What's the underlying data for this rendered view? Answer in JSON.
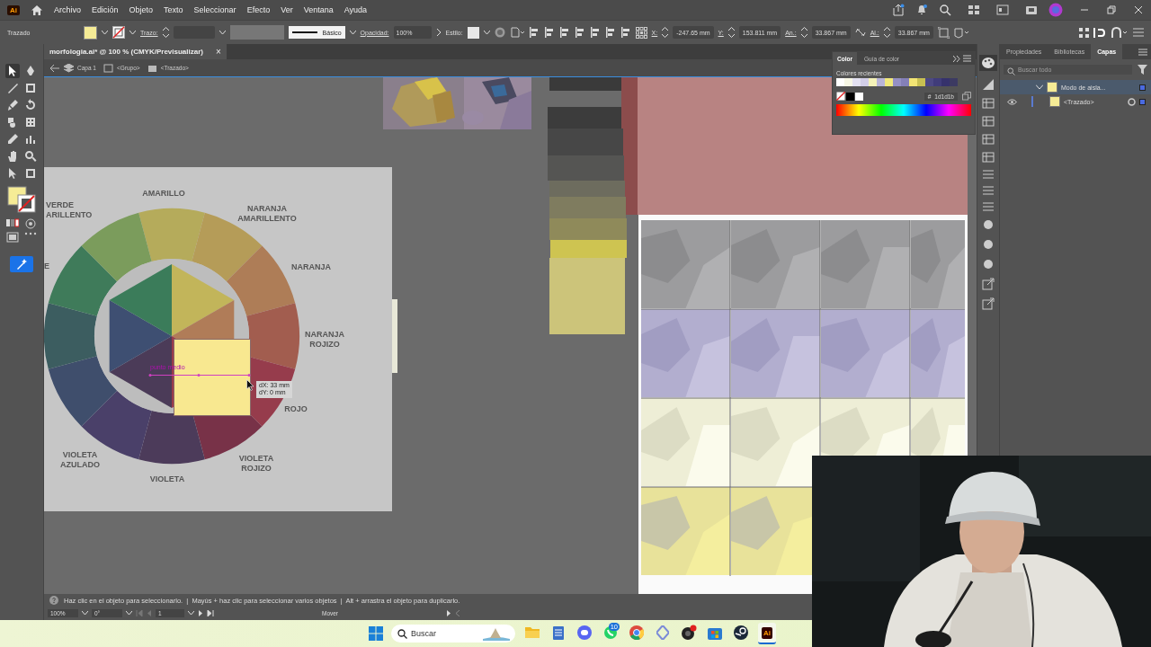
{
  "app_logo": "Ai",
  "menu": [
    "Archivo",
    "Edición",
    "Objeto",
    "Texto",
    "Seleccionar",
    "Efecto",
    "Ver",
    "Ventana",
    "Ayuda"
  ],
  "control_bar": {
    "selection": "Trazado",
    "stroke_label": "Trazo:",
    "stroke_profile": "Básico",
    "opacity_label": "Opacidad:",
    "opacity": "100%",
    "style_label": "Estilo:",
    "x_label": "X:",
    "x": "-247.65 mm",
    "y_label": "Y:",
    "y": "153.811 mm",
    "width_label": "An.:",
    "width": "33.867 mm",
    "height_label": "Al.:",
    "height": "33.867 mm"
  },
  "document_tab": {
    "title": "morfologia.ai* @ 100 % (CMYK/Previsualizar)",
    "close": "×"
  },
  "breadcrumb": [
    "Capa 1",
    "<Grupo>",
    "<Trazado>"
  ],
  "color_wheel": {
    "labels": [
      {
        "lines": [
          "VERDE",
          "ARILLENTO"
        ]
      },
      {
        "lines": [
          "AMARILLO"
        ]
      },
      {
        "lines": [
          "NARANJA",
          "AMARILLENTO"
        ]
      },
      {
        "lines": [
          "E"
        ]
      },
      {
        "lines": [
          "NARANJA"
        ]
      },
      {
        "lines": [
          "NARANJA",
          "ROJIZO"
        ]
      },
      {
        "lines": [
          "ROJO"
        ]
      },
      {
        "lines": [
          "VIOLETA",
          "AZULADO"
        ]
      },
      {
        "lines": [
          "VIOLETA"
        ]
      },
      {
        "lines": [
          "VIOLETA",
          "ROJIZO"
        ]
      }
    ],
    "guide_label": "punto medio",
    "tooltip": {
      "dx": "dX: 33 mm",
      "dy": "dY: 0 mm"
    }
  },
  "color_panel": {
    "tabs": [
      {
        "label": "Color",
        "selected": true
      },
      {
        "label": "Guía de color",
        "selected": false
      }
    ],
    "recent_label": "Colores recientes",
    "recent_colors": [
      {
        "color": "#ffffff"
      },
      {
        "color": "#f6f6e4"
      },
      {
        "color": "#e2e0f0"
      },
      {
        "color": "#d2cee8"
      },
      {
        "color": "#f4f2b8"
      },
      {
        "color": "#b8b4d8"
      },
      {
        "color": "#f0e87a"
      },
      {
        "color": "#9490c4"
      },
      {
        "color": "#8480b8"
      },
      {
        "color": "#f2e474"
      },
      {
        "color": "#c8c052"
      },
      {
        "color": "#4c4884"
      },
      {
        "color": "#403c7a"
      },
      {
        "color": "#36326c"
      },
      {
        "color": "#3c3a62"
      }
    ],
    "hex_symbol": "#",
    "hex": "1d1d1b"
  },
  "layers_panel": {
    "tabs": [
      {
        "label": "Propiedades",
        "selected": false
      },
      {
        "label": "Bibliotecas",
        "selected": false
      },
      {
        "label": "Capas",
        "selected": true
      }
    ],
    "search": {
      "placeholder": "Buscar todo"
    },
    "layers": [
      {
        "name": "Modo de aisla...",
        "expanded": true,
        "selected": true,
        "children": [
          {
            "name": "<Trazado>",
            "selected": false
          }
        ]
      }
    ]
  },
  "status_bar": {
    "hint": "Haz clic en el objeto para seleccionarlo.  |  Mayús + haz clic para seleccionar varios objetos  |  Alt + arrastra el objeto para duplicarlo.",
    "zoom": "100%",
    "rotation": "0°",
    "artboard": "1",
    "tool": "Mover"
  },
  "taskbar": {
    "search": {
      "placeholder": "Buscar"
    },
    "apps": [
      {
        "kind": "folder",
        "selected": false
      },
      {
        "kind": "notes",
        "selected": false
      },
      {
        "kind": "chat",
        "selected": false
      },
      {
        "kind": "phone",
        "selected": false,
        "badge": "10"
      },
      {
        "kind": "browser",
        "selected": false
      },
      {
        "kind": "diamond",
        "selected": false
      },
      {
        "kind": "recorder",
        "selected": false
      },
      {
        "kind": "store",
        "selected": false
      },
      {
        "kind": "steam",
        "selected": false
      },
      {
        "kind": "illustrator",
        "selected": true,
        "label": "Ai"
      }
    ]
  }
}
